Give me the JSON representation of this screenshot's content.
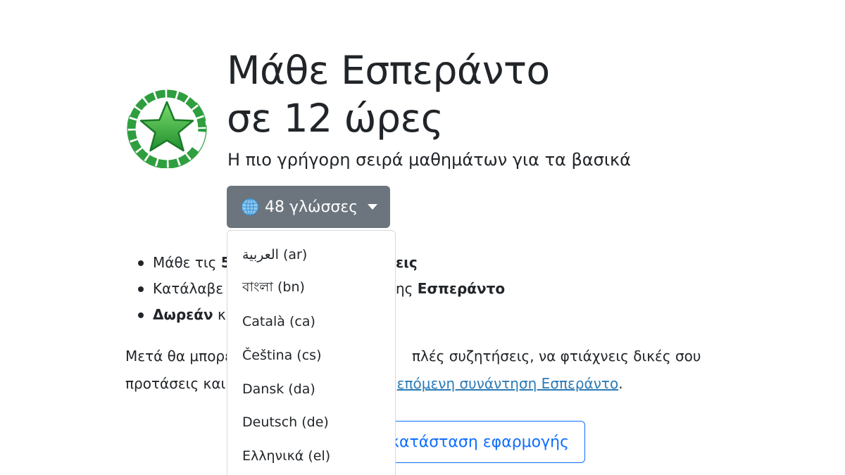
{
  "header": {
    "title_line1": "Μάθε Εσπεράντο",
    "title_line2": "σε 12 ώρες",
    "subtitle": "Η πιο γρήγορη σειρά μαθημάτων για τα βασικά"
  },
  "language_button": {
    "label": "48 γλώσσες",
    "icon": "globe-icon"
  },
  "bullets": [
    {
      "prefix": "Μάθε τις ",
      "bold": "5"
    },
    {
      "prefix": "Κατάλαβε τ",
      "tail": "ης ",
      "tail_bold": "Εσπεράντο"
    },
    {
      "bold": "Δωρεάν",
      "prefix": " κ"
    }
  ],
  "paragraph": {
    "line1_start": "Μετά θα μπορε",
    "line1_end": "πλές συζητήσεις, να φτιάχνεις δικές σου",
    "line2_start": "προτάσεις και ",
    "link": "επόμενη συνάντηση Εσπεράντο",
    "line2_end": "."
  },
  "app_button": {
    "label": "κατάσταση εφαρμογής"
  },
  "dropdown": {
    "items": [
      "العربية (ar)",
      "বাংলা (bn)",
      "Català (ca)",
      "Čeština (cs)",
      "Dansk (da)",
      "Deutsch (de)",
      "Ελληνικά (el)"
    ]
  },
  "colors": {
    "button_gray": "#6c757d",
    "primary_blue": "#0d6efd",
    "link_blue": "#2c7bb6",
    "logo_green": "#2e9e3f"
  },
  "logo": {
    "icon": "star-icon"
  }
}
